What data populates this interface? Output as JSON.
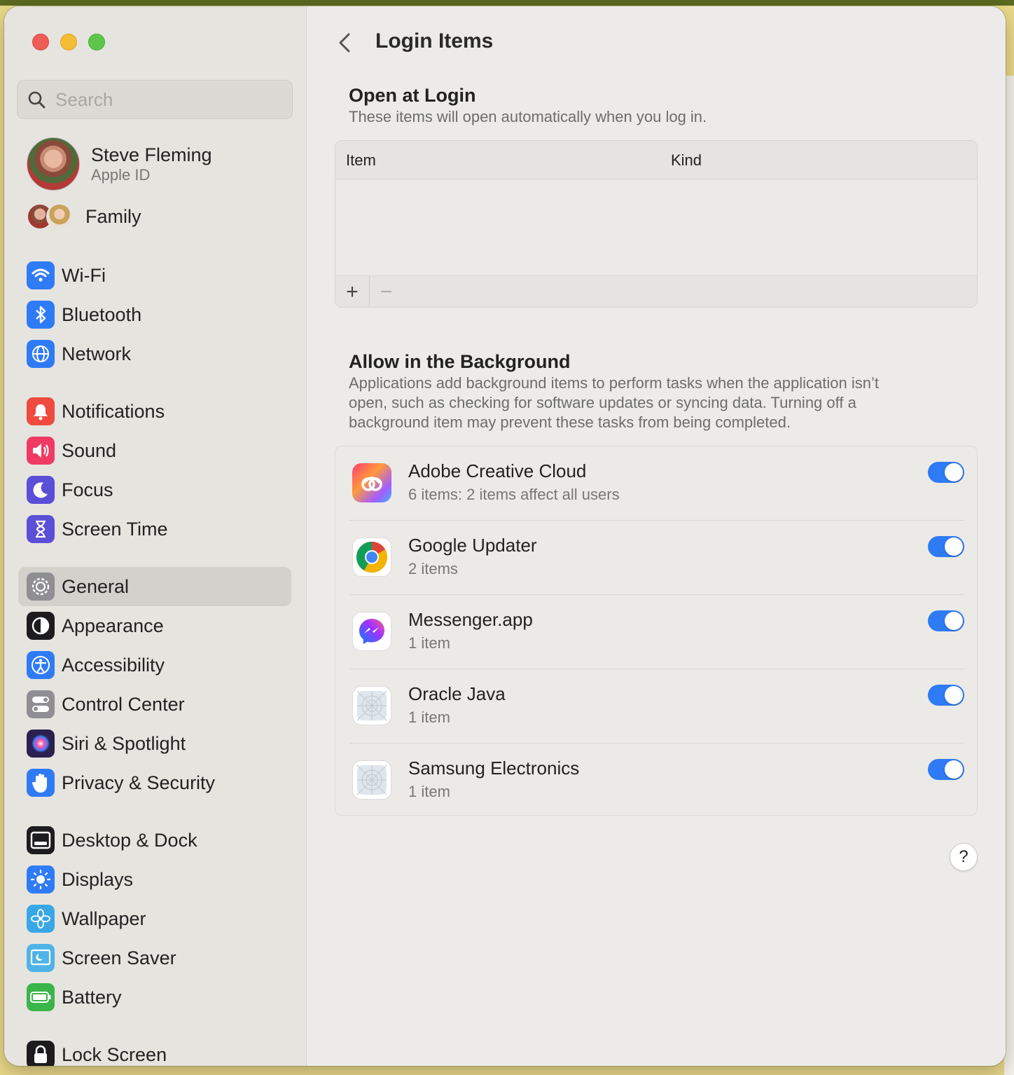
{
  "sidebar": {
    "search_placeholder": "Search",
    "profile": {
      "name": "Steve Fleming",
      "subtitle": "Apple ID"
    },
    "family_label": "Family",
    "items": [
      {
        "label": "Wi-Fi",
        "icon": "wifi-icon",
        "color": "#2f7bf5"
      },
      {
        "label": "Bluetooth",
        "icon": "bluetooth-icon",
        "color": "#2f7bf5"
      },
      {
        "label": "Network",
        "icon": "globe-icon",
        "color": "#2f7bf5"
      },
      {
        "label": "Notifications",
        "icon": "bell-icon",
        "color": "#ef4a3f"
      },
      {
        "label": "Sound",
        "icon": "speaker-icon",
        "color": "#ef3b64"
      },
      {
        "label": "Focus",
        "icon": "moon-icon",
        "color": "#5b4fd8"
      },
      {
        "label": "Screen Time",
        "icon": "hourglass-icon",
        "color": "#5b4fd8"
      },
      {
        "label": "General",
        "icon": "gear-icon",
        "color": "#8e8e93"
      },
      {
        "label": "Appearance",
        "icon": "appearance-icon",
        "color": "#1c1c1e"
      },
      {
        "label": "Accessibility",
        "icon": "accessibility-icon",
        "color": "#2f7bf5"
      },
      {
        "label": "Control Center",
        "icon": "switches-icon",
        "color": "#8e8e93"
      },
      {
        "label": "Siri & Spotlight",
        "icon": "siri-icon",
        "color": "#2a2150"
      },
      {
        "label": "Privacy & Security",
        "icon": "hand-icon",
        "color": "#2f7bf5"
      },
      {
        "label": "Desktop & Dock",
        "icon": "dock-icon",
        "color": "#1c1c1e"
      },
      {
        "label": "Displays",
        "icon": "sun-icon",
        "color": "#2f7bf5"
      },
      {
        "label": "Wallpaper",
        "icon": "flower-icon",
        "color": "#39a7e6"
      },
      {
        "label": "Screen Saver",
        "icon": "screensaver-icon",
        "color": "#4fb3e8"
      },
      {
        "label": "Battery",
        "icon": "battery-icon",
        "color": "#3ab54a"
      },
      {
        "label": "Lock Screen",
        "icon": "lock-icon",
        "color": "#1c1c1e"
      }
    ],
    "selected": "General"
  },
  "main": {
    "title": "Login Items",
    "open_at_login": {
      "title": "Open at Login",
      "description": "These items will open automatically when you log in.",
      "columns": [
        "Item",
        "Kind"
      ],
      "add_label": "+",
      "remove_label": "−"
    },
    "background": {
      "title": "Allow in the Background",
      "description_lines": [
        "Applications add background items to perform tasks when the application isn’t",
        "open, such as checking for software updates or syncing data. Turning off a",
        "background item may prevent these tasks from being completed."
      ],
      "items": [
        {
          "name": "Adobe Creative Cloud",
          "detail": "6 items: 2 items affect all users",
          "enabled": true,
          "icon": "adobe-cc-icon"
        },
        {
          "name": "Google Updater",
          "detail": "2 items",
          "enabled": true,
          "icon": "chrome-icon"
        },
        {
          "name": "Messenger.app",
          "detail": "1 item",
          "enabled": true,
          "icon": "messenger-icon"
        },
        {
          "name": "Oracle Java",
          "detail": "1 item",
          "enabled": true,
          "icon": "generic-app-icon"
        },
        {
          "name": "Samsung Electronics",
          "detail": "1 item",
          "enabled": true,
          "icon": "generic-app-icon"
        }
      ]
    },
    "help_label": "?"
  },
  "colors": {
    "accent": "#2f7bf5"
  }
}
